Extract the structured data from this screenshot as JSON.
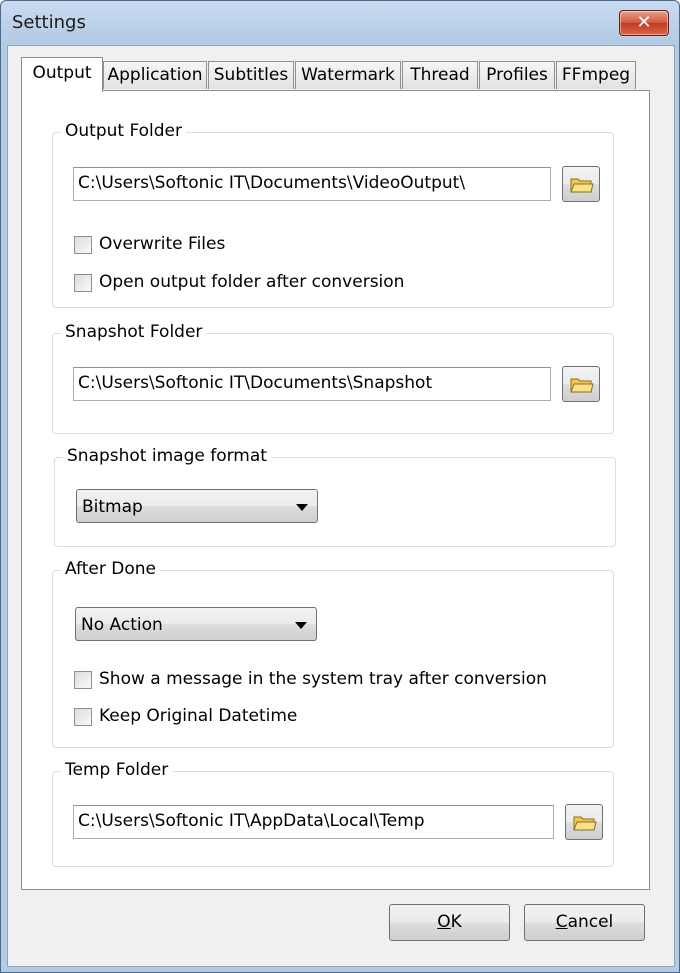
{
  "window": {
    "title": "Settings",
    "close_glyph": "✕"
  },
  "tabs": [
    "Output",
    "Application",
    "Subtitles",
    "Watermark",
    "Thread",
    "Profiles",
    "FFmpeg"
  ],
  "output_folder": {
    "legend": "Output Folder",
    "path": "C:\\Users\\Softonic IT\\Documents\\VideoOutput\\",
    "browse_icon": "folder-icon",
    "overwrite_label": "Overwrite Files",
    "overwrite_checked": false,
    "open_after_label": "Open output folder after conversion",
    "open_after_checked": false
  },
  "snapshot_folder": {
    "legend": "Snapshot Folder",
    "path": "C:\\Users\\Softonic IT\\Documents\\Snapshot",
    "browse_icon": "folder-icon"
  },
  "snapshot_format": {
    "legend": "Snapshot image format",
    "selected": "Bitmap"
  },
  "after_done": {
    "legend": "After Done",
    "selected": "No Action",
    "tray_msg_label": "Show a message in the system tray after conversion",
    "tray_msg_checked": false,
    "keep_datetime_label": "Keep Original Datetime",
    "keep_datetime_checked": false
  },
  "temp_folder": {
    "legend": "Temp Folder",
    "path": "C:\\Users\\Softonic IT\\AppData\\Local\\Temp",
    "browse_icon": "folder-icon"
  },
  "buttons": {
    "ok_mnemonic": "O",
    "ok_rest": "K",
    "cancel_mnemonic": "C",
    "cancel_rest": "ancel"
  }
}
